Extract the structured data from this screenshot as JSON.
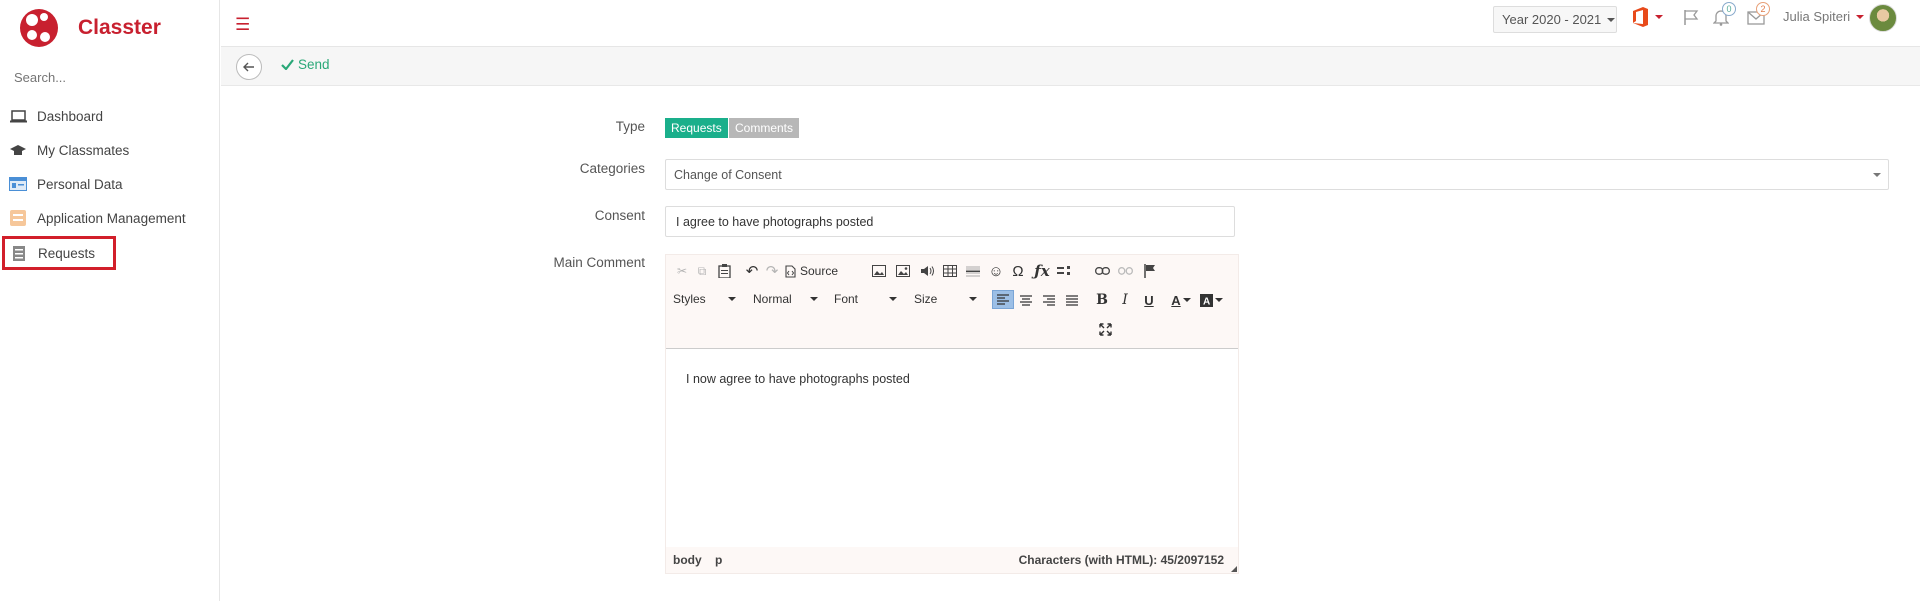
{
  "app": {
    "name": "Classter"
  },
  "sidebar": {
    "search_placeholder": "Search...",
    "items": [
      {
        "label": "Dashboard",
        "icon": "laptop-icon"
      },
      {
        "label": "My Classmates",
        "icon": "graduation-cap-icon"
      },
      {
        "label": "Personal Data",
        "icon": "id-card-icon"
      },
      {
        "label": "Application Management",
        "icon": "form-icon"
      },
      {
        "label": "Requests",
        "icon": "list-icon"
      }
    ]
  },
  "header": {
    "year_select": "Year 2020 - 2021",
    "notifications_count": "0",
    "messages_count": "2",
    "user_name": "Julia Spiteri"
  },
  "actions": {
    "send_label": "Send"
  },
  "form": {
    "type_label": "Type",
    "type_options": [
      "Requests",
      "Comments"
    ],
    "type_selected": "Requests",
    "categories_label": "Categories",
    "categories_value": "Change of Consent",
    "consent_label": "Consent",
    "consent_value": "I agree to have photographs posted",
    "main_comment_label": "Main Comment"
  },
  "editor": {
    "source_label": "Source",
    "styles_combo": "Styles",
    "format_combo": "Normal",
    "font_combo": "Font",
    "size_combo": "Size",
    "content": "I now agree to have photographs posted",
    "path_body": "body",
    "path_p": "p",
    "char_count": "Characters (with HTML): 45/2097152"
  },
  "colors": {
    "brand": "#c8202f",
    "accent": "#1aaf8b",
    "inactive": "#b7b7b7"
  }
}
